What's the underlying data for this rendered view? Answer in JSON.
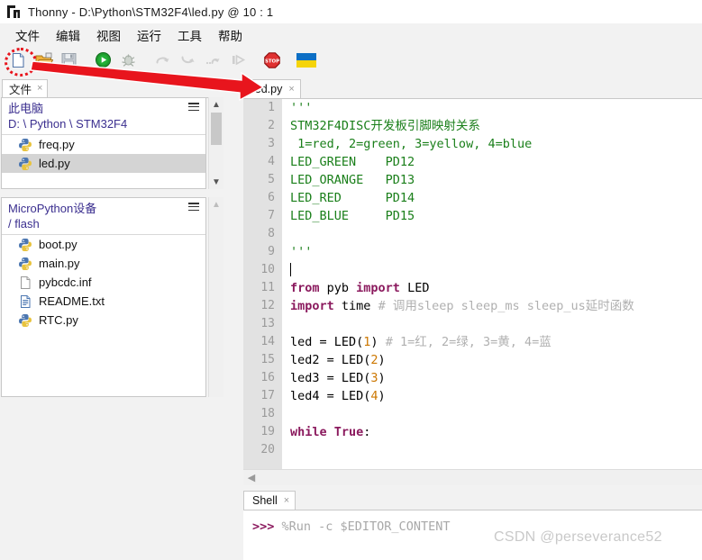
{
  "window": {
    "app_name": "Thonny",
    "title": "Thonny  -  D:\\Python\\STM32F4\\led.py  @  10 : 1",
    "icon": "thonny-icon"
  },
  "menubar": {
    "items": [
      {
        "label": "文件",
        "name": "menu-file"
      },
      {
        "label": "编辑",
        "name": "menu-edit"
      },
      {
        "label": "视图",
        "name": "menu-view"
      },
      {
        "label": "运行",
        "name": "menu-run"
      },
      {
        "label": "工具",
        "name": "menu-tools"
      },
      {
        "label": "帮助",
        "name": "menu-help"
      }
    ]
  },
  "toolbar": {
    "buttons": [
      {
        "name": "new-file-icon",
        "tooltip": "新建",
        "enabled": true,
        "highlighted": true
      },
      {
        "name": "open-folder-icon",
        "tooltip": "打开",
        "enabled": true,
        "highlighted": false
      },
      {
        "name": "save-icon",
        "tooltip": "保存",
        "enabled": false,
        "highlighted": false
      },
      {
        "name": "run-icon",
        "tooltip": "运行",
        "enabled": true,
        "highlighted": false
      },
      {
        "name": "debug-bug-icon",
        "tooltip": "调试",
        "enabled": false,
        "highlighted": false
      },
      {
        "name": "step-over-icon",
        "tooltip": "跳过",
        "enabled": false,
        "highlighted": false
      },
      {
        "name": "step-into-icon",
        "tooltip": "跳入",
        "enabled": false,
        "highlighted": false
      },
      {
        "name": "step-out-icon",
        "tooltip": "跳出",
        "enabled": false,
        "highlighted": false
      },
      {
        "name": "resume-icon",
        "tooltip": "继续",
        "enabled": false,
        "highlighted": false
      },
      {
        "name": "stop-icon",
        "tooltip": "停止",
        "enabled": true,
        "highlighted": false
      },
      {
        "name": "ukraine-flag-icon",
        "tooltip": "Ukraine",
        "enabled": true,
        "highlighted": false
      }
    ]
  },
  "sidebar": {
    "tab": {
      "label": "文件",
      "close": "×"
    },
    "local": {
      "header": "此电脑",
      "path": "D: \\ Python \\ STM32F4",
      "menu_icon": "hamburger-icon",
      "files": [
        {
          "name": "freq.py",
          "icon": "python-file-icon",
          "selected": false
        },
        {
          "name": "led.py",
          "icon": "python-file-icon",
          "selected": true
        }
      ]
    },
    "device": {
      "header": "MicroPython设备",
      "path": "/ flash",
      "menu_icon": "hamburger-icon",
      "files": [
        {
          "name": "boot.py",
          "icon": "python-file-icon",
          "selected": false
        },
        {
          "name": "main.py",
          "icon": "python-file-icon",
          "selected": false
        },
        {
          "name": "pybcdc.inf",
          "icon": "generic-file-icon",
          "selected": false
        },
        {
          "name": "README.txt",
          "icon": "text-file-icon",
          "selected": false
        },
        {
          "name": "RTC.py",
          "icon": "python-file-icon",
          "selected": false
        }
      ]
    }
  },
  "editor": {
    "tab": {
      "label": "led.py",
      "close": "×"
    },
    "cursor_position": "10 : 1",
    "line_numbers": [
      1,
      2,
      3,
      4,
      5,
      6,
      7,
      8,
      9,
      10,
      11,
      12,
      13,
      14,
      15,
      16,
      17,
      18,
      19,
      20
    ],
    "lines": [
      {
        "n": 1,
        "tokens": [
          {
            "t": "'''",
            "c": "str"
          }
        ]
      },
      {
        "n": 2,
        "tokens": [
          {
            "t": "STM32F4DISC开发板引脚映射关系",
            "c": "str"
          }
        ]
      },
      {
        "n": 3,
        "tokens": [
          {
            "t": " 1=red, 2=green, 3=yellow, 4=blue",
            "c": "str"
          }
        ]
      },
      {
        "n": 4,
        "tokens": [
          {
            "t": "LED_GREEN    PD12",
            "c": "str"
          }
        ]
      },
      {
        "n": 5,
        "tokens": [
          {
            "t": "LED_ORANGE   PD13",
            "c": "str"
          }
        ]
      },
      {
        "n": 6,
        "tokens": [
          {
            "t": "LED_RED      PD14",
            "c": "str"
          }
        ]
      },
      {
        "n": 7,
        "tokens": [
          {
            "t": "LED_BLUE     PD15",
            "c": "str"
          }
        ]
      },
      {
        "n": 8,
        "tokens": []
      },
      {
        "n": 9,
        "tokens": [
          {
            "t": "'''",
            "c": "str"
          }
        ]
      },
      {
        "n": 10,
        "tokens": [],
        "caret": true
      },
      {
        "n": 11,
        "tokens": [
          {
            "t": "from",
            "c": "kw"
          },
          {
            "t": " pyb ",
            "c": "plain"
          },
          {
            "t": "import",
            "c": "kw"
          },
          {
            "t": " LED",
            "c": "plain"
          }
        ]
      },
      {
        "n": 12,
        "tokens": [
          {
            "t": "import",
            "c": "kw"
          },
          {
            "t": " time ",
            "c": "plain"
          },
          {
            "t": "# 调用sleep sleep_ms sleep_us延时函数",
            "c": "com"
          }
        ]
      },
      {
        "n": 13,
        "tokens": []
      },
      {
        "n": 14,
        "tokens": [
          {
            "t": "led = LED(",
            "c": "plain"
          },
          {
            "t": "1",
            "c": "num"
          },
          {
            "t": ") ",
            "c": "plain"
          },
          {
            "t": "# 1=红, 2=绿, 3=黄, 4=蓝",
            "c": "com"
          }
        ]
      },
      {
        "n": 15,
        "tokens": [
          {
            "t": "led2 = LED(",
            "c": "plain"
          },
          {
            "t": "2",
            "c": "num"
          },
          {
            "t": ")",
            "c": "plain"
          }
        ]
      },
      {
        "n": 16,
        "tokens": [
          {
            "t": "led3 = LED(",
            "c": "plain"
          },
          {
            "t": "3",
            "c": "num"
          },
          {
            "t": ")",
            "c": "plain"
          }
        ]
      },
      {
        "n": 17,
        "tokens": [
          {
            "t": "led4 = LED(",
            "c": "plain"
          },
          {
            "t": "4",
            "c": "num"
          },
          {
            "t": ")",
            "c": "plain"
          }
        ]
      },
      {
        "n": 18,
        "tokens": []
      },
      {
        "n": 19,
        "tokens": [
          {
            "t": "while",
            "c": "kw"
          },
          {
            "t": " ",
            "c": "plain"
          },
          {
            "t": "True",
            "c": "kw"
          },
          {
            "t": ":",
            "c": "plain"
          }
        ]
      },
      {
        "n": 20,
        "tokens": []
      }
    ]
  },
  "shell": {
    "tab": {
      "label": "Shell",
      "close": "×"
    },
    "prompt": ">>>",
    "command": " %Run -c $EDITOR_CONTENT"
  },
  "annotations": {
    "watermark": "CSDN @perseverance52",
    "ellipse_target": "new-file-icon",
    "arrow_color": "#e8151d",
    "ellipse_color": "#e8151d"
  },
  "colors": {
    "string_green": "#1a7f1a",
    "keyword_purple": "#8b1a5e",
    "number_orange": "#cc7700",
    "comment_gray": "#b0b0b0",
    "tree_header_blue": "#3b2f8f",
    "selection_gray": "#d4d4d4",
    "annotation_red": "#e8151d"
  }
}
